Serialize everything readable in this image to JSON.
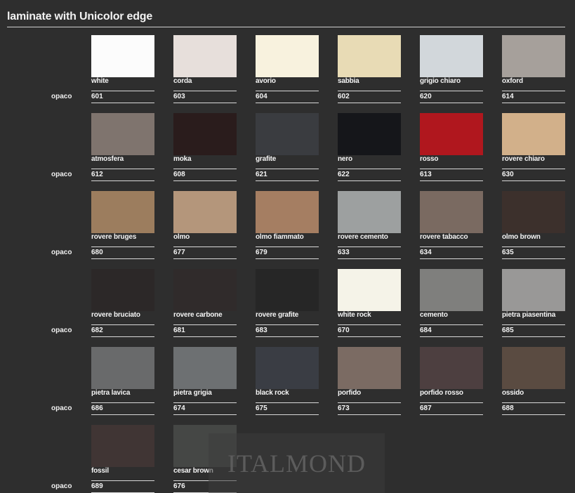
{
  "header": {
    "title": "laminate with Unicolor edge"
  },
  "finish_label": "opaco",
  "watermark": "ITALMOND",
  "rows": [
    [
      {
        "name": "white",
        "code": "601",
        "color": "#fcfcfc"
      },
      {
        "name": "corda",
        "code": "603",
        "color": "#e7dfdb"
      },
      {
        "name": "avorio",
        "code": "604",
        "color": "#f8f2de"
      },
      {
        "name": "sabbia",
        "code": "602",
        "color": "#e8dbb5"
      },
      {
        "name": "grigio chiaro",
        "code": "620",
        "color": "#d2d7db"
      },
      {
        "name": "oxford",
        "code": "614",
        "color": "#a6a09b"
      }
    ],
    [
      {
        "name": "atmosfera",
        "code": "612",
        "color": "#7f746e"
      },
      {
        "name": "moka",
        "code": "608",
        "color": "#2a1c1c"
      },
      {
        "name": "grafite",
        "code": "621",
        "color": "#3a3c40"
      },
      {
        "name": "nero",
        "code": "622",
        "color": "#15161a"
      },
      {
        "name": "rosso",
        "code": "613",
        "color": "#b0171e"
      },
      {
        "name": "rovere chiaro",
        "code": "630",
        "color": "#d2b08a"
      }
    ],
    [
      {
        "name": "rovere bruges",
        "code": "680",
        "color": "#9c7d5e"
      },
      {
        "name": "olmo",
        "code": "677",
        "color": "#b4967b"
      },
      {
        "name": "olmo fiammato",
        "code": "679",
        "color": "#a57e62"
      },
      {
        "name": "rovere cemento",
        "code": "633",
        "color": "#9da0a0"
      },
      {
        "name": "rovere tabacco",
        "code": "634",
        "color": "#7a6a61"
      },
      {
        "name": "olmo brown",
        "code": "635",
        "color": "#3c302c"
      }
    ],
    [
      {
        "name": "rovere bruciato",
        "code": "682",
        "color": "#2c2828"
      },
      {
        "name": "rovere carbone",
        "code": "681",
        "color": "#302b2b"
      },
      {
        "name": "rovere grafite",
        "code": "683",
        "color": "#262626"
      },
      {
        "name": "white rock",
        "code": "670",
        "color": "#f5f3e8"
      },
      {
        "name": "cemento",
        "code": "684",
        "color": "#7f7f7d"
      },
      {
        "name": "pietra piasentina",
        "code": "685",
        "color": "#999897"
      }
    ],
    [
      {
        "name": "pietra lavica",
        "code": "686",
        "color": "#696a6b"
      },
      {
        "name": "pietra grigia",
        "code": "674",
        "color": "#6d7072"
      },
      {
        "name": "black rock",
        "code": "675",
        "color": "#3a3d44"
      },
      {
        "name": "porfido",
        "code": "673",
        "color": "#7b6b63"
      },
      {
        "name": "porfido rosso",
        "code": "687",
        "color": "#4d3f40"
      },
      {
        "name": "ossido",
        "code": "688",
        "color": "#5a4b41"
      }
    ],
    [
      {
        "name": "fossil",
        "code": "689",
        "color": "#403534"
      },
      {
        "name": "cesar brown",
        "code": "676",
        "color": "#454745"
      }
    ]
  ]
}
